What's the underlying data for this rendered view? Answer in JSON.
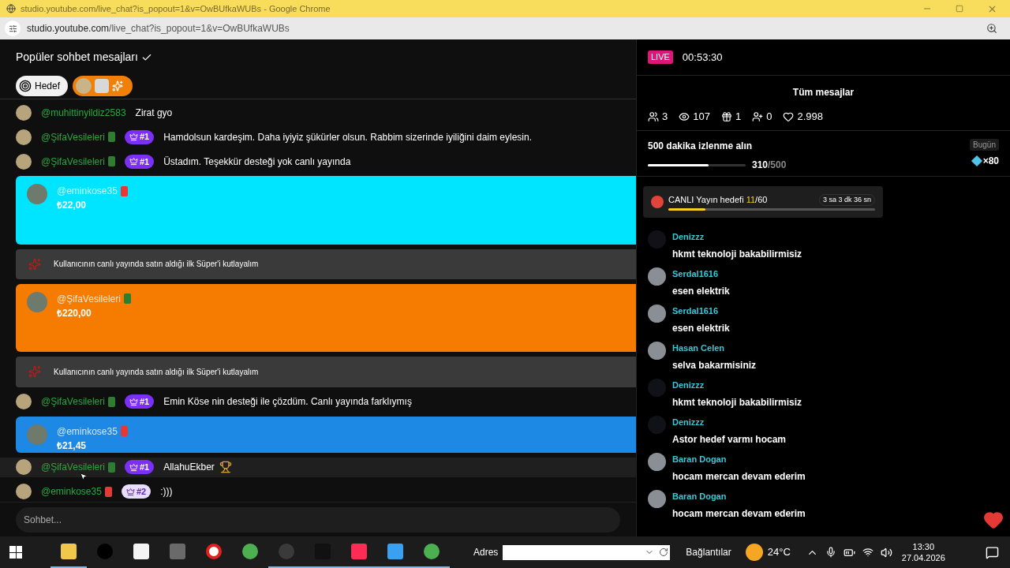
{
  "window": {
    "title": "studio.youtube.com/live_chat?is_popout=1&v=OwBUfkaWUBs - Google Chrome",
    "url_host": "studio.youtube.com",
    "url_path": "/live_chat?is_popout=1&v=OwBUfkaWUBs"
  },
  "chat": {
    "title": "Popüler sohbet mesajları",
    "goal_chip": "Hedef",
    "input_placeholder": "Sohbet...",
    "messages": [
      {
        "kind": "chat",
        "author": "@muhittinyildiz2583",
        "text": "Zirat gyo",
        "hovered": false
      },
      {
        "kind": "chat",
        "author": "@ŞifaVesileleri",
        "badge": {
          "color": "#2e7d32"
        },
        "rank": "#1",
        "top": true,
        "text": "Hamdolsun kardeşim. Daha iyiyiz şükürler olsun. Rabbim sizerinde iyiliğini daim eylesin.",
        "trophy": false,
        "hovered": false
      },
      {
        "kind": "chat",
        "author": "@ŞifaVesileleri",
        "badge": {
          "color": "#2e7d32"
        },
        "rank": "#1",
        "top": true,
        "text": "Üstadım. Teşekkür desteği yok canlı yayında",
        "trophy": false,
        "hovered": false
      },
      {
        "kind": "superchat",
        "author": "@eminkose35",
        "badge": {
          "color": "#e53935"
        },
        "amount": "₺22,00",
        "color": "#00e5ff",
        "expanded": true
      },
      {
        "kind": "notice",
        "text": "Kullanıcının canlı yayında satın aldığı ilk Süper'i kutlayalım"
      },
      {
        "kind": "superchat",
        "author": "@ŞifaVesileleri",
        "badge": {
          "color": "#2e7d32"
        },
        "amount": "₺220,00",
        "color": "#f57c00",
        "expanded": true
      },
      {
        "kind": "notice",
        "text": "Kullanıcının canlı yayında satın aldığı ilk Süper'i kutlayalım"
      },
      {
        "kind": "chat",
        "author": "@ŞifaVesileleri",
        "badge": {
          "color": "#2e7d32"
        },
        "rank": "#1",
        "top": true,
        "text": "Emin Köse nin desteği ile çözdüm. Canlı yayında farklıymış",
        "trophy": false,
        "hovered": false
      },
      {
        "kind": "superchat",
        "author": "@eminkose35",
        "badge": {
          "color": "#e53935"
        },
        "amount": "₺21,45",
        "color": "#1e88e5",
        "expanded": false
      },
      {
        "kind": "chat",
        "author": "@ŞifaVesileleri",
        "badge": {
          "color": "#2e7d32"
        },
        "rank": "#1",
        "top": true,
        "text": "AllahuEkber",
        "trophy": true,
        "hovered": true
      },
      {
        "kind": "chat",
        "author": "@eminkose35",
        "badge": {
          "color": "#e53935"
        },
        "rank": "#2",
        "top": false,
        "text": ":)))",
        "trophy": false,
        "hovered": false
      }
    ]
  },
  "live": {
    "badge": "LIVE",
    "timer": "00:53:30",
    "filter": "Tüm mesajlar",
    "stats": [
      {
        "kind": "users",
        "value": "3"
      },
      {
        "kind": "views",
        "value": "107"
      },
      {
        "kind": "gifts",
        "value": "1"
      },
      {
        "kind": "follows",
        "value": "0"
      },
      {
        "kind": "likes",
        "value": "2.998"
      }
    ],
    "quest": {
      "title": "500 dakika izlenme alın",
      "level": 0.62,
      "done": "310",
      "total": "/500",
      "tag": "Bugün",
      "reward": "×80"
    },
    "goal": {
      "label": "CANLI Yayın hedefi ",
      "current": "11",
      "total": "/60",
      "level": 0.18,
      "remaining": "3 sa 3 dk 36 sn"
    },
    "comments": [
      {
        "name": "Denizzz",
        "text": "hkmt teknoloji bakabilirmisiz",
        "has_photo": false
      },
      {
        "name": "Serdal1616",
        "text": "esen elektrik",
        "has_photo": true
      },
      {
        "name": "Serdal1616",
        "text": "esen elektrik",
        "has_photo": true
      },
      {
        "name": "Hasan Celen",
        "text": "selva bakarmisiniz",
        "has_photo": true
      },
      {
        "name": "Denizzz",
        "text": "hkmt teknoloji bakabilirmisiz",
        "has_photo": false
      },
      {
        "name": "Denizzz",
        "text": "Astor hedef varmı hocam",
        "has_photo": false
      },
      {
        "name": "Baran Dogan",
        "text": "hocam mercan devam ederim",
        "has_photo": true
      },
      {
        "name": "Baran Dogan",
        "text": "hocam mercan devam ederim",
        "has_photo": true
      }
    ]
  },
  "taskbar": {
    "apps": [
      {
        "running": true
      },
      {
        "running": false
      },
      {
        "running": false
      },
      {
        "running": false
      },
      {
        "running": false
      },
      {
        "running": false
      },
      {
        "running": true
      },
      {
        "running": true
      },
      {
        "running": true
      },
      {
        "running": true
      },
      {
        "running": true
      }
    ],
    "address_label": "Adres",
    "links": "Bağlantılar",
    "temperature": "24°C",
    "time": "13:30",
    "date": "27.04.2026"
  }
}
